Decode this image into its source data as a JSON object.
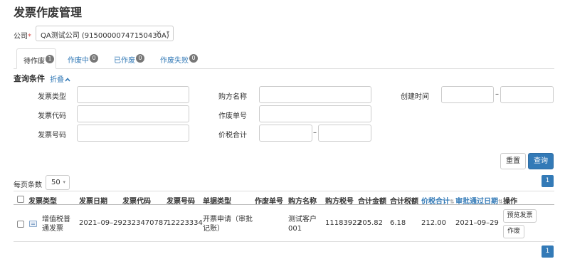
{
  "page": {
    "title": "发票作废管理"
  },
  "company": {
    "label": "公司",
    "required_mark": "*",
    "selected": "QA测试公司 (91500000747150430A)",
    "clear": "×",
    "caret": "▾"
  },
  "tabs": [
    {
      "label": "待作废",
      "count": "1"
    },
    {
      "label": "作废中",
      "count": "0"
    },
    {
      "label": "已作废",
      "count": "0"
    },
    {
      "label": "作废失败",
      "count": "0"
    }
  ],
  "query": {
    "title": "查询条件",
    "fold_label": "折叠",
    "fields": {
      "invoice_type": "发票类型",
      "invoice_code": "发票代码",
      "invoice_number": "发票号码",
      "buyer_name": "购方名称",
      "void_order_no": "作废单号",
      "total_amount": "价税合计",
      "created_time": "创建时间"
    },
    "range_sep": "–",
    "reset_label": "重置",
    "search_label": "查询"
  },
  "pagination": {
    "page_size_label": "每页条数",
    "page_size": "50",
    "current_page": "1"
  },
  "table": {
    "columns": [
      "发票类型",
      "发票日期",
      "发票代码",
      "发票号码",
      "单据类型",
      "作废单号",
      "购方名称",
      "购方税号",
      "合计金额",
      "合计税额",
      "价税合计",
      "审批通过日期",
      "操作"
    ],
    "rows": [
      {
        "invoice_type_l1": "增值税普",
        "invoice_type_l2": "通发票",
        "date": "2021–09–29",
        "code": "2323470787",
        "number": "12223334",
        "doc_type_l1": "开票申请（审批",
        "doc_type_l2": "记账）",
        "void_no": "",
        "buyer_l1": "测试客户",
        "buyer_l2": "001",
        "tax_id": "11183922",
        "amount": "205.82",
        "tax": "6.18",
        "total": "212.00",
        "approval_date": "2021–09–29",
        "action_preview": "预览发票",
        "action_void": "作废"
      }
    ]
  },
  "icons": {
    "sort": "sort-icon",
    "doc": "document-icon",
    "fold": "chevron-up-icon"
  }
}
